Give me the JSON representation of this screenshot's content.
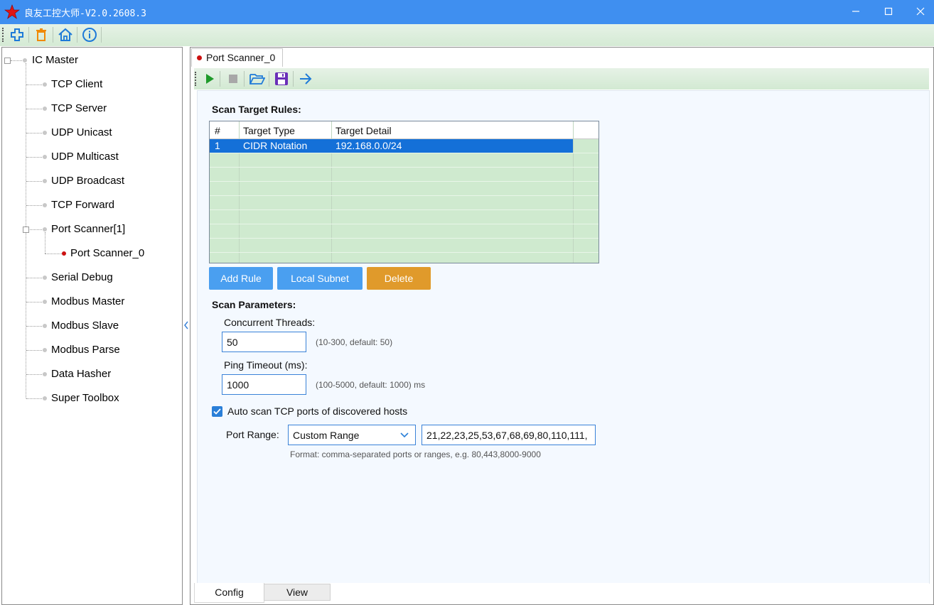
{
  "window": {
    "title": "良友工控大师-V2.0.2608.3",
    "minimize_icon": "minimize-icon",
    "maximize_icon": "maximize-icon",
    "close_icon": "close-icon"
  },
  "toolbar": {
    "icons": [
      "add-icon",
      "delete-icon",
      "home-icon",
      "info-icon"
    ]
  },
  "tree": {
    "root": "IC Master",
    "items": [
      {
        "label": "TCP Client"
      },
      {
        "label": "TCP Server"
      },
      {
        "label": "UDP Unicast"
      },
      {
        "label": "UDP Multicast"
      },
      {
        "label": "UDP Broadcast"
      },
      {
        "label": "TCP Forward"
      },
      {
        "label": "Port Scanner[1]"
      },
      {
        "label": "Port Scanner_0"
      },
      {
        "label": "Serial Debug"
      },
      {
        "label": "Modbus Master"
      },
      {
        "label": "Modbus Slave"
      },
      {
        "label": "Modbus Parse"
      },
      {
        "label": "Data Hasher"
      },
      {
        "label": "Super Toolbox"
      }
    ]
  },
  "document_tab": {
    "label": "Port Scanner_0"
  },
  "inner_toolbar": {
    "icons": [
      "play-icon",
      "stop-icon",
      "open-folder-icon",
      "save-icon",
      "arrow-right-icon"
    ]
  },
  "scan_rules": {
    "title": "Scan Target Rules:",
    "columns": [
      "#",
      "Target Type",
      "Target Detail"
    ],
    "rows": [
      {
        "num": "1",
        "type": "CIDR Notation",
        "detail": "192.168.0.0/24"
      }
    ],
    "buttons": {
      "add": "Add Rule",
      "subnet": "Local Subnet",
      "delete": "Delete"
    },
    "colors": {
      "primary_button": "#4a9ff0",
      "delete_button": "#e09a2b",
      "grid_bg": "#cfeacf",
      "selected_row": "#1470d8"
    }
  },
  "scan_params": {
    "title": "Scan Parameters:",
    "threads_label": "Concurrent Threads:",
    "threads_value": "50",
    "threads_hint": "(10-300, default: 50)",
    "timeout_label": "Ping Timeout (ms):",
    "timeout_value": "1000",
    "timeout_hint": "(100-5000, default: 1000) ms",
    "autoscan_label": "Auto scan TCP ports of discovered hosts",
    "autoscan_checked": true,
    "port_range_label": "Port Range:",
    "port_range_selected": "Custom Range",
    "port_range_value": "21,22,23,25,53,67,68,69,80,110,111,",
    "port_range_hint": "Format: comma-separated ports or ranges, e.g. 80,443,8000-9000"
  },
  "bottom_tabs": [
    {
      "label": "Config"
    },
    {
      "label": "View"
    }
  ]
}
